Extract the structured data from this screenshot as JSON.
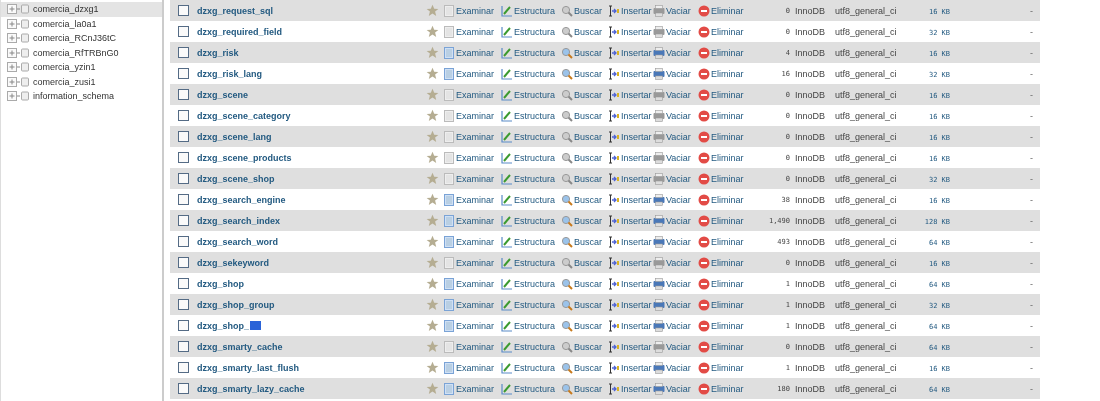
{
  "sidebar": {
    "items": [
      {
        "name": "comercia_dzxg1",
        "selected": true
      },
      {
        "name": "comercia_la0a1",
        "selected": false
      },
      {
        "name": "comercia_RCnJ36tC",
        "selected": false
      },
      {
        "name": "comercia_RfTRBnG0",
        "selected": false
      },
      {
        "name": "comercia_yzin1",
        "selected": false
      },
      {
        "name": "comercia_zusi1",
        "selected": false
      },
      {
        "name": "information_schema",
        "selected": false
      }
    ]
  },
  "table": {
    "rows": [
      {
        "name": "dzxg_request_sql",
        "highlight": false,
        "checked": false,
        "empty": true,
        "actions": [
          "Examinar",
          "Estructura",
          "Buscar",
          "Insertar",
          "Vaciar",
          "Eliminar"
        ],
        "rows": "0",
        "engine": "InnoDB",
        "collation": "utf8_general_ci",
        "size": "16 KB",
        "overhead": "-"
      },
      {
        "name": "dzxg_required_field",
        "highlight": false,
        "checked": false,
        "empty": true,
        "actions": [
          "Examinar",
          "Estructura",
          "Buscar",
          "Insertar",
          "Vaciar",
          "Eliminar"
        ],
        "rows": "0",
        "engine": "InnoDB",
        "collation": "utf8_general_ci",
        "size": "32 KB",
        "overhead": "-"
      },
      {
        "name": "dzxg_risk",
        "highlight": false,
        "checked": false,
        "empty": false,
        "actions": [
          "Examinar",
          "Estructura",
          "Buscar",
          "Insertar",
          "Vaciar",
          "Eliminar"
        ],
        "rows": "4",
        "engine": "InnoDB",
        "collation": "utf8_general_ci",
        "size": "16 KB",
        "overhead": "-"
      },
      {
        "name": "dzxg_risk_lang",
        "highlight": false,
        "checked": false,
        "empty": false,
        "actions": [
          "Examinar",
          "Estructura",
          "Buscar",
          "Insertar",
          "Vaciar",
          "Eliminar"
        ],
        "rows": "16",
        "engine": "InnoDB",
        "collation": "utf8_general_ci",
        "size": "32 KB",
        "overhead": "-"
      },
      {
        "name": "dzxg_scene",
        "highlight": false,
        "checked": false,
        "empty": true,
        "actions": [
          "Examinar",
          "Estructura",
          "Buscar",
          "Insertar",
          "Vaciar",
          "Eliminar"
        ],
        "rows": "0",
        "engine": "InnoDB",
        "collation": "utf8_general_ci",
        "size": "16 KB",
        "overhead": "-"
      },
      {
        "name": "dzxg_scene_category",
        "highlight": false,
        "checked": false,
        "empty": true,
        "actions": [
          "Examinar",
          "Estructura",
          "Buscar",
          "Insertar",
          "Vaciar",
          "Eliminar"
        ],
        "rows": "0",
        "engine": "InnoDB",
        "collation": "utf8_general_ci",
        "size": "16 KB",
        "overhead": "-"
      },
      {
        "name": "dzxg_scene_lang",
        "highlight": false,
        "checked": false,
        "empty": true,
        "actions": [
          "Examinar",
          "Estructura",
          "Buscar",
          "Insertar",
          "Vaciar",
          "Eliminar"
        ],
        "rows": "0",
        "engine": "InnoDB",
        "collation": "utf8_general_ci",
        "size": "16 KB",
        "overhead": "-"
      },
      {
        "name": "dzxg_scene_products",
        "highlight": false,
        "checked": false,
        "empty": true,
        "actions": [
          "Examinar",
          "Estructura",
          "Buscar",
          "Insertar",
          "Vaciar",
          "Eliminar"
        ],
        "rows": "0",
        "engine": "InnoDB",
        "collation": "utf8_general_ci",
        "size": "16 KB",
        "overhead": "-"
      },
      {
        "name": "dzxg_scene_shop",
        "highlight": false,
        "checked": false,
        "empty": true,
        "actions": [
          "Examinar",
          "Estructura",
          "Buscar",
          "Insertar",
          "Vaciar",
          "Eliminar"
        ],
        "rows": "0",
        "engine": "InnoDB",
        "collation": "utf8_general_ci",
        "size": "32 KB",
        "overhead": "-"
      },
      {
        "name": "dzxg_search_engine",
        "highlight": false,
        "checked": false,
        "empty": false,
        "actions": [
          "Examinar",
          "Estructura",
          "Buscar",
          "Insertar",
          "Vaciar",
          "Eliminar"
        ],
        "rows": "38",
        "engine": "InnoDB",
        "collation": "utf8_general_ci",
        "size": "16 KB",
        "overhead": "-"
      },
      {
        "name": "dzxg_search_index",
        "highlight": false,
        "checked": false,
        "empty": false,
        "actions": [
          "Examinar",
          "Estructura",
          "Buscar",
          "Insertar",
          "Vaciar",
          "Eliminar"
        ],
        "rows": "1,490",
        "engine": "InnoDB",
        "collation": "utf8_general_ci",
        "size": "128 KB",
        "overhead": "-"
      },
      {
        "name": "dzxg_search_word",
        "highlight": false,
        "checked": false,
        "empty": false,
        "actions": [
          "Examinar",
          "Estructura",
          "Buscar",
          "Insertar",
          "Vaciar",
          "Eliminar"
        ],
        "rows": "493",
        "engine": "InnoDB",
        "collation": "utf8_general_ci",
        "size": "64 KB",
        "overhead": "-"
      },
      {
        "name": "dzxg_sekeyword",
        "highlight": false,
        "checked": false,
        "empty": true,
        "actions": [
          "Examinar",
          "Estructura",
          "Buscar",
          "Insertar",
          "Vaciar",
          "Eliminar"
        ],
        "rows": "0",
        "engine": "InnoDB",
        "collation": "utf8_general_ci",
        "size": "16 KB",
        "overhead": "-"
      },
      {
        "name": "dzxg_shop",
        "highlight": false,
        "checked": false,
        "empty": false,
        "actions": [
          "Examinar",
          "Estructura",
          "Buscar",
          "Insertar",
          "Vaciar",
          "Eliminar"
        ],
        "rows": "1",
        "engine": "InnoDB",
        "collation": "utf8_general_ci",
        "size": "64 KB",
        "overhead": "-"
      },
      {
        "name": "dzxg_shop_group",
        "highlight": false,
        "checked": false,
        "empty": false,
        "actions": [
          "Examinar",
          "Estructura",
          "Buscar",
          "Insertar",
          "Vaciar",
          "Eliminar"
        ],
        "rows": "1",
        "engine": "InnoDB",
        "collation": "utf8_general_ci",
        "size": "32 KB",
        "overhead": "-"
      },
      {
        "name": "dzxg_shop_",
        "highlight": true,
        "checked": false,
        "empty": false,
        "actions": [
          "Examinar",
          "Estructura",
          "Buscar",
          "Insertar",
          "Vaciar",
          "Eliminar"
        ],
        "rows": "1",
        "engine": "InnoDB",
        "collation": "utf8_general_ci",
        "size": "64 KB",
        "overhead": "-"
      },
      {
        "name": "dzxg_smarty_cache",
        "highlight": false,
        "checked": false,
        "empty": true,
        "actions": [
          "Examinar",
          "Estructura",
          "Buscar",
          "Insertar",
          "Vaciar",
          "Eliminar"
        ],
        "rows": "0",
        "engine": "InnoDB",
        "collation": "utf8_general_ci",
        "size": "64 KB",
        "overhead": "-"
      },
      {
        "name": "dzxg_smarty_last_flush",
        "highlight": false,
        "checked": false,
        "empty": false,
        "actions": [
          "Examinar",
          "Estructura",
          "Buscar",
          "Insertar",
          "Vaciar",
          "Eliminar"
        ],
        "rows": "1",
        "engine": "InnoDB",
        "collation": "utf8_general_ci",
        "size": "16 KB",
        "overhead": "-"
      },
      {
        "name": "dzxg_smarty_lazy_cache",
        "highlight": false,
        "checked": false,
        "empty": false,
        "actions": [
          "Examinar",
          "Estructura",
          "Buscar",
          "Insertar",
          "Vaciar",
          "Eliminar"
        ],
        "rows": "180",
        "engine": "InnoDB",
        "collation": "utf8_general_ci",
        "size": "64 KB",
        "overhead": "-"
      }
    ]
  }
}
